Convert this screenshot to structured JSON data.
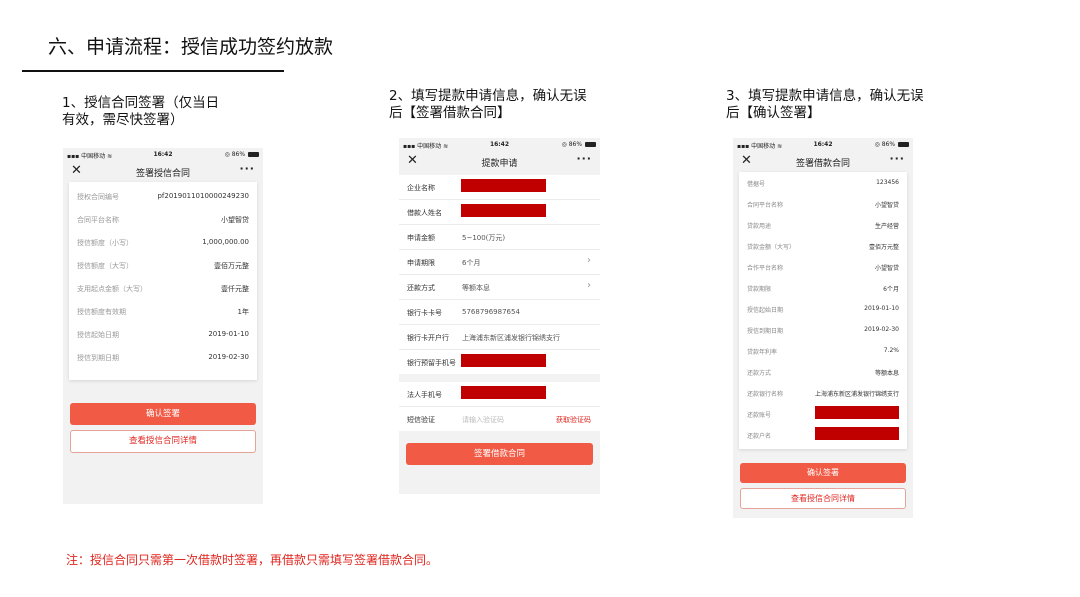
{
  "slide": {
    "title": "六、申请流程：授信成功签约放款",
    "note": "注：授信合同只需第一次借款时签署，再借款只需填写签署借款合同。"
  },
  "colors": {
    "accent": "#f15a45",
    "redaction": "#c00000",
    "note": "#e0261f"
  },
  "status_bar": {
    "carrier": "中国移动",
    "time": "16:42",
    "battery": "86%"
  },
  "steps": [
    {
      "caption_line1": "1、授信合同签署（仅当日",
      "caption_line2": "有效，需尽快签署）",
      "nav_title": "签署授信合同",
      "rows": [
        {
          "label": "授权合同编号",
          "value": "pf2019011010000249230"
        },
        {
          "label": "合同平台名称",
          "value": "小望智贷"
        },
        {
          "label": "授信额度（小写）",
          "value": "1,000,000.00"
        },
        {
          "label": "授信额度（大写）",
          "value": "壹佰万元整"
        },
        {
          "label": "支用起点金额（大写）",
          "value": "壹仟元整"
        },
        {
          "label": "授信额度有效期",
          "value": "1年"
        },
        {
          "label": "授信起始日期",
          "value": "2019-01-10"
        },
        {
          "label": "授信到期日期",
          "value": "2019-02-30"
        }
      ],
      "primary_button": "确认签署",
      "secondary_button": "查看授信合同详情"
    },
    {
      "caption_line1": "2、填写提款申请信息，确认无误",
      "caption_line2": "后【签署借款合同】",
      "nav_title": "提款申请",
      "rows": [
        {
          "label": "企业名称"
        },
        {
          "label": "借款人姓名"
        },
        {
          "label": "申请金额",
          "value": "5~100(万元)"
        },
        {
          "label": "申请期限",
          "value": "6个月"
        },
        {
          "label": "还款方式",
          "value": "等额本息"
        },
        {
          "label": "银行卡卡号",
          "value": "5768796987654"
        },
        {
          "label": "银行卡开户行",
          "value": "上海浦东新区浦发银行锦绣支行"
        },
        {
          "label": "银行预留手机号"
        },
        {
          "label": "法人手机号"
        },
        {
          "label": "短信验证",
          "placeholder": "请输入验证码",
          "link": "获取验证码"
        }
      ],
      "primary_button": "签署借款合同"
    },
    {
      "caption_line1": "3、填写提款申请信息，确认无误",
      "caption_line2": "后【确认签署】",
      "nav_title": "签署借款合同",
      "rows": [
        {
          "label": "借据号",
          "value": "123456"
        },
        {
          "label": "合同平台名称",
          "value": "小望智贷"
        },
        {
          "label": "贷款用途",
          "value": "生产经营"
        },
        {
          "label": "贷款金额（大写）",
          "value": "壹佰万元整"
        },
        {
          "label": "合作平台名称",
          "value": "小望智贷"
        },
        {
          "label": "贷款期限",
          "value": "6个月"
        },
        {
          "label": "授信起始日期",
          "value": "2019-01-10"
        },
        {
          "label": "授信到期日期",
          "value": "2019-02-30"
        },
        {
          "label": "贷款年利率",
          "value": "7.2%"
        },
        {
          "label": "还款方式",
          "value": "等额本息"
        },
        {
          "label": "还款银行名称",
          "value": "上海浦东新区浦发银行锦绣支行"
        },
        {
          "label": "还款账号"
        },
        {
          "label": "还款户名"
        }
      ],
      "primary_button": "确认签署",
      "secondary_button": "查看授信合同详情"
    }
  ]
}
